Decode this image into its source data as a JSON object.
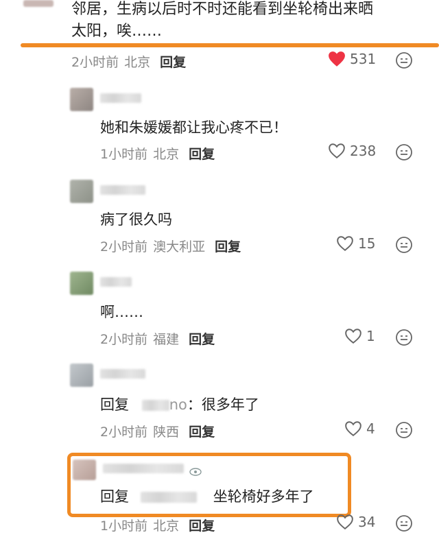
{
  "colors": {
    "accent_orange": "#f08a24",
    "like_red": "#ee3344",
    "meta_gray": "#888888",
    "text_dark": "#222222"
  },
  "top_comment": {
    "text_line1": "邻居，生病以后时不时还能看到坐轮椅出来晒",
    "text_line2": "太阳，唉……",
    "time": "2小时前",
    "location": "北京",
    "reply_label": "回复",
    "likes": "531",
    "liked": true
  },
  "replies": [
    {
      "text": "她和朱媛媛都让我心疼不已！",
      "time": "1小时前",
      "location": "北京",
      "reply_label": "回复",
      "likes": "238"
    },
    {
      "text": "病了很久吗",
      "time": "2小时前",
      "location": "澳大利亚",
      "reply_label": "回复",
      "likes": "15"
    },
    {
      "text": "啊……",
      "time": "2小时前",
      "location": "福建",
      "reply_label": "回复",
      "likes": "1"
    },
    {
      "reply_prefix": "回复",
      "mention_tail": "no",
      "text": "：很多年了",
      "time": "2小时前",
      "location": "陕西",
      "reply_label": "回复",
      "likes": "4"
    },
    {
      "reply_prefix": "回复",
      "text": "坐轮椅好多年了",
      "time": "1小时前",
      "location": "北京",
      "reply_label": "回复",
      "likes": "34",
      "highlighted": true
    }
  ],
  "icons": {
    "like": "heart-icon",
    "more": "emoji-face-icon"
  }
}
